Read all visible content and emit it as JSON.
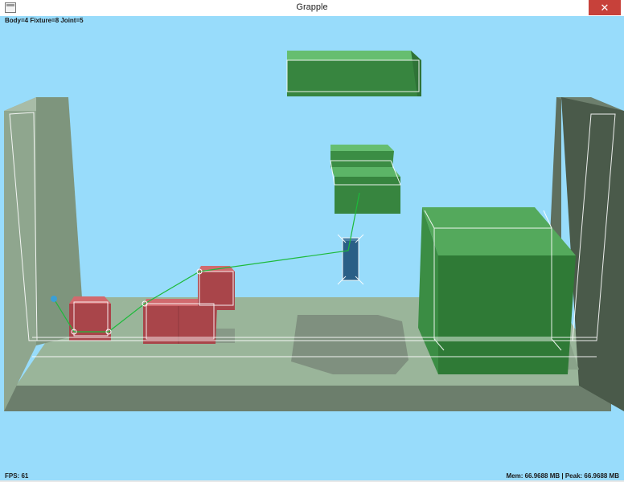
{
  "window": {
    "title": "Grapple",
    "close_glyph": "✕",
    "app_icon": "window-icon"
  },
  "hud": {
    "stats": "Body=4 Fixture=8 Joint=5",
    "fps": "FPS: 61",
    "memory": "Mem: 66.9688 MB | Peak: 66.9688 MB"
  },
  "colors": {
    "sky": "#98dcfb",
    "floor": "#9ab59a",
    "floor_front": "#6c7e6c",
    "left_wall": "#8da48c",
    "right_wall": "#4d5d4d",
    "green_block": "#3f9e4c",
    "red_box": "#b14a4f",
    "blue_piece": "#2a5f86",
    "wireframe": "#ffffff",
    "rope": "#1dba3b"
  }
}
